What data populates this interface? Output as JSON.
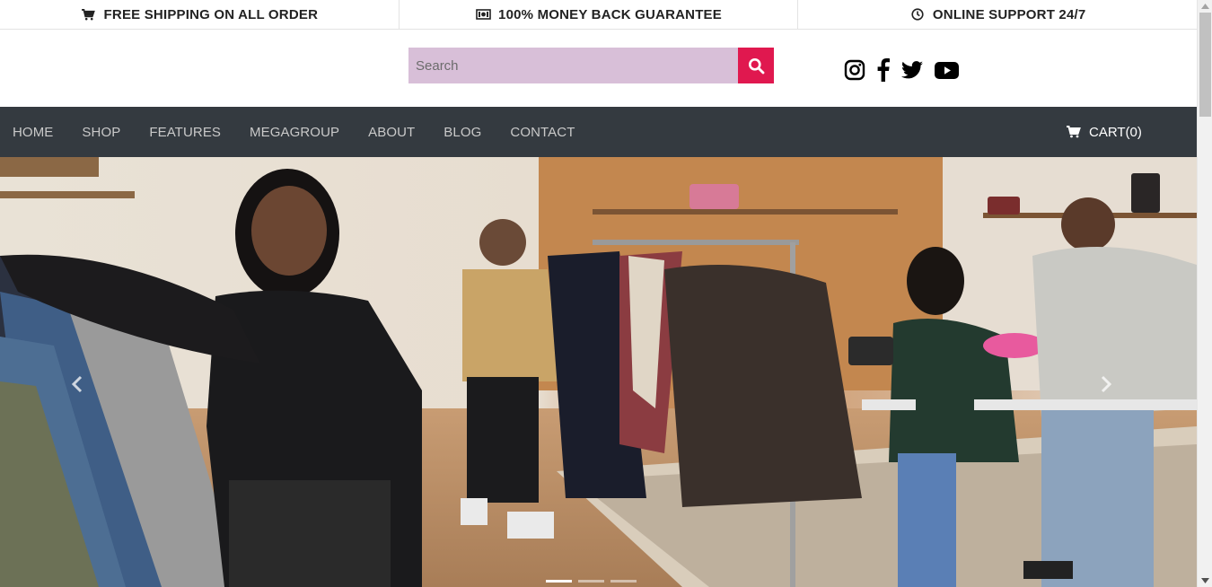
{
  "topbar": {
    "items": [
      {
        "icon": "cart-icon",
        "label": "FREE SHIPPING ON ALL ORDER"
      },
      {
        "icon": "money-icon",
        "label": "100% MONEY BACK GUARANTEE"
      },
      {
        "icon": "clock-icon",
        "label": "ONLINE SUPPORT 24/7"
      }
    ]
  },
  "header": {
    "search": {
      "placeholder": "Search",
      "value": "",
      "button_icon": "search-icon",
      "button_color": "#e0184f",
      "field_color": "#d8bfd8"
    },
    "social": [
      "instagram-icon",
      "facebook-icon",
      "twitter-icon",
      "youtube-icon"
    ]
  },
  "nav": {
    "background": "#343a40",
    "items": [
      "HOME",
      "SHOP",
      "FEATURES",
      "MEGAGROUP",
      "ABOUT",
      "BLOG",
      "CONTACT"
    ],
    "cart_label": "CART(0)"
  },
  "hero": {
    "slide_count": 3,
    "active_slide": 1,
    "prev_icon": "chevron-left-icon",
    "next_icon": "chevron-right-icon"
  }
}
